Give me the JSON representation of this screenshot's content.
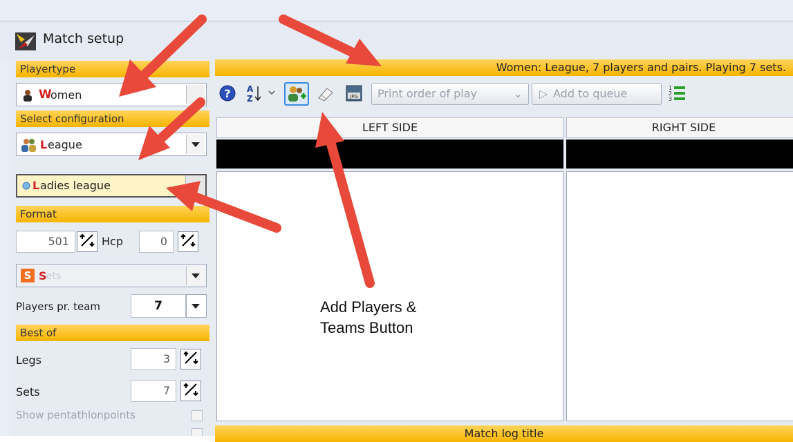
{
  "window": {
    "title": "Match setup"
  },
  "sidebar": {
    "playertype_header": "Playertype",
    "playertype_value": "Women",
    "playertype_value_initial": "W",
    "playertype_value_rest": "omen",
    "config_header": "Select configuration",
    "config_value": "League",
    "config_value_initial": "L",
    "config_value_rest": "eague",
    "league_value": "Ladies league",
    "league_value_initial": "L",
    "league_value_rest": "adies league",
    "format_header": "Format",
    "score_value": "501",
    "hcp_label": "Hcp",
    "hcp_value": "0",
    "mode_badge": "S",
    "mode_value": "Sets",
    "mode_value_initial": "S",
    "mode_value_rest": "ets",
    "players_label": "Players pr. team",
    "players_value": "7",
    "bestof_header": "Best of",
    "legs_label": "Legs",
    "legs_value": "3",
    "sets_label": "Sets",
    "sets_value": "7",
    "pentathlon_label": "Show pentathlonpoints"
  },
  "main": {
    "status_text": "Women: League, 7 players and pairs. Playing 7 sets.",
    "toolbar": {
      "help_icon": "help-icon",
      "sort_icon": "sort-az-icon",
      "add_players_icon": "add-players-teams-icon",
      "eraser_icon": "eraser-icon",
      "jpeg_icon": "jpeg-icon",
      "jpeg_label": "JPG",
      "print_label": "Print order of play",
      "queue_label": "Add to queue",
      "list_icon": "numbered-list-icon"
    },
    "left_header": "LEFT SIDE",
    "right_header": "RIGHT SIDE",
    "footer_title": "Match log title"
  },
  "annotation": {
    "line1": "Add Players &",
    "line2": "Teams Button"
  },
  "colors": {
    "header_gradient_top": "#ffd45a",
    "header_gradient_bottom": "#f7b400",
    "arrow": "#e8493a",
    "accent_red": "#d42020"
  }
}
